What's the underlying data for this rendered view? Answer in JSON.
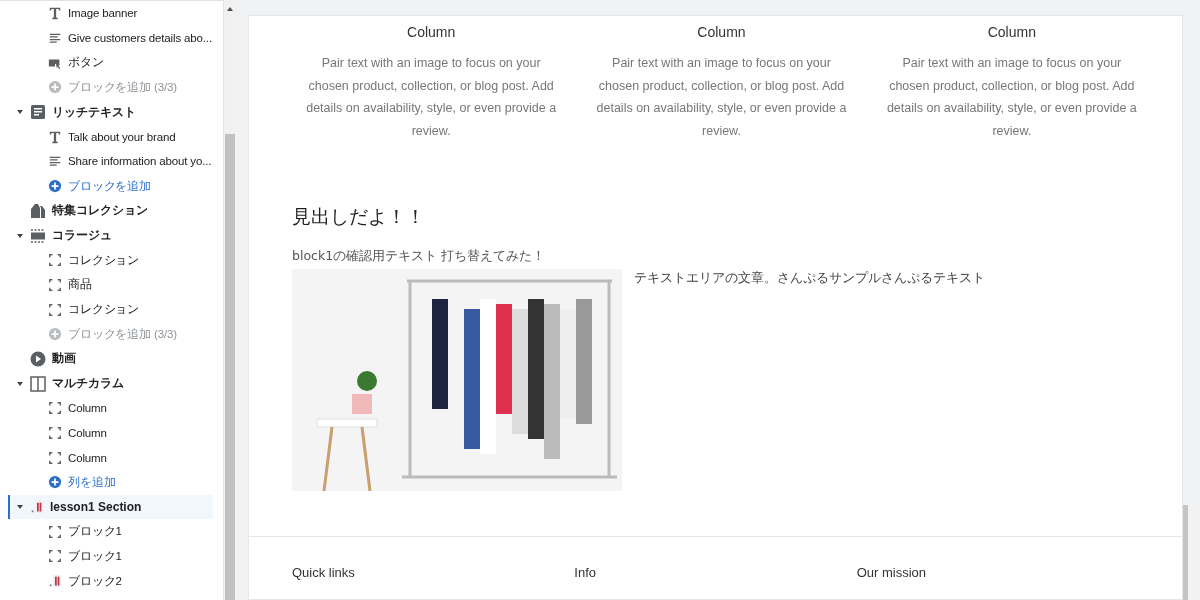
{
  "sidebar": {
    "sections": [
      {
        "children": [
          {
            "label": "Image banner",
            "kind": "heading"
          },
          {
            "label": "Give customers details abo...",
            "kind": "paragraph"
          },
          {
            "label": "ボタン",
            "kind": "button"
          },
          {
            "label": "ブロックを追加 (3/3)",
            "kind": "add",
            "disabled": true
          }
        ]
      },
      {
        "label": "リッチテキスト",
        "kind": "richtext",
        "expanded": true,
        "selected": false,
        "children": [
          {
            "label": "Talk about your brand",
            "kind": "heading"
          },
          {
            "label": "Share information about yo...",
            "kind": "paragraph"
          },
          {
            "label": "ブロックを追加",
            "kind": "add",
            "disabled": false
          }
        ]
      },
      {
        "label": "特集コレクション",
        "kind": "collection",
        "selected": false
      },
      {
        "label": "コラージュ",
        "kind": "collage",
        "expanded": true,
        "selected": false,
        "children": [
          {
            "label": "コレクション",
            "kind": "block"
          },
          {
            "label": "商品",
            "kind": "block"
          },
          {
            "label": "コレクション",
            "kind": "block"
          },
          {
            "label": "ブロックを追加 (3/3)",
            "kind": "add",
            "disabled": true
          }
        ]
      },
      {
        "label": "動画",
        "kind": "video",
        "selected": false
      },
      {
        "label": "マルチカラム",
        "kind": "multicolumn",
        "expanded": true,
        "selected": false,
        "children": [
          {
            "label": "Column",
            "kind": "block"
          },
          {
            "label": "Column",
            "kind": "block"
          },
          {
            "label": "Column",
            "kind": "block"
          },
          {
            "label": "列を追加",
            "kind": "add",
            "disabled": false
          }
        ]
      },
      {
        "label": "lesson1 Section",
        "kind": "custom",
        "expanded": true,
        "selected": true,
        "children": [
          {
            "label": "ブロック1",
            "kind": "block"
          },
          {
            "label": "ブロック1",
            "kind": "block"
          },
          {
            "label": "ブロック2",
            "kind": "image"
          }
        ]
      }
    ]
  },
  "preview": {
    "columns": [
      {
        "title": "Column",
        "text": "Pair text with an image to focus on your chosen product, collection, or blog post. Add details on availability, style, or even provide a review."
      },
      {
        "title": "Column",
        "text": "Pair text with an image to focus on your chosen product, collection, or blog post. Add details on availability, style, or even provide a review."
      },
      {
        "title": "Column",
        "text": "Pair text with an image to focus on your chosen product, collection, or blog post. Add details on availability, style, or even provide a review."
      }
    ],
    "lesson": {
      "heading": "見出しだよ！！",
      "block_text": "block1の確認用テキスト 打ち替えてみた！",
      "side_text": "テキストエリアの文章。さんぷるサンプルさんぷるテキスト"
    },
    "footer": {
      "headings": [
        "Quick links",
        "Info",
        "Our mission"
      ]
    }
  }
}
